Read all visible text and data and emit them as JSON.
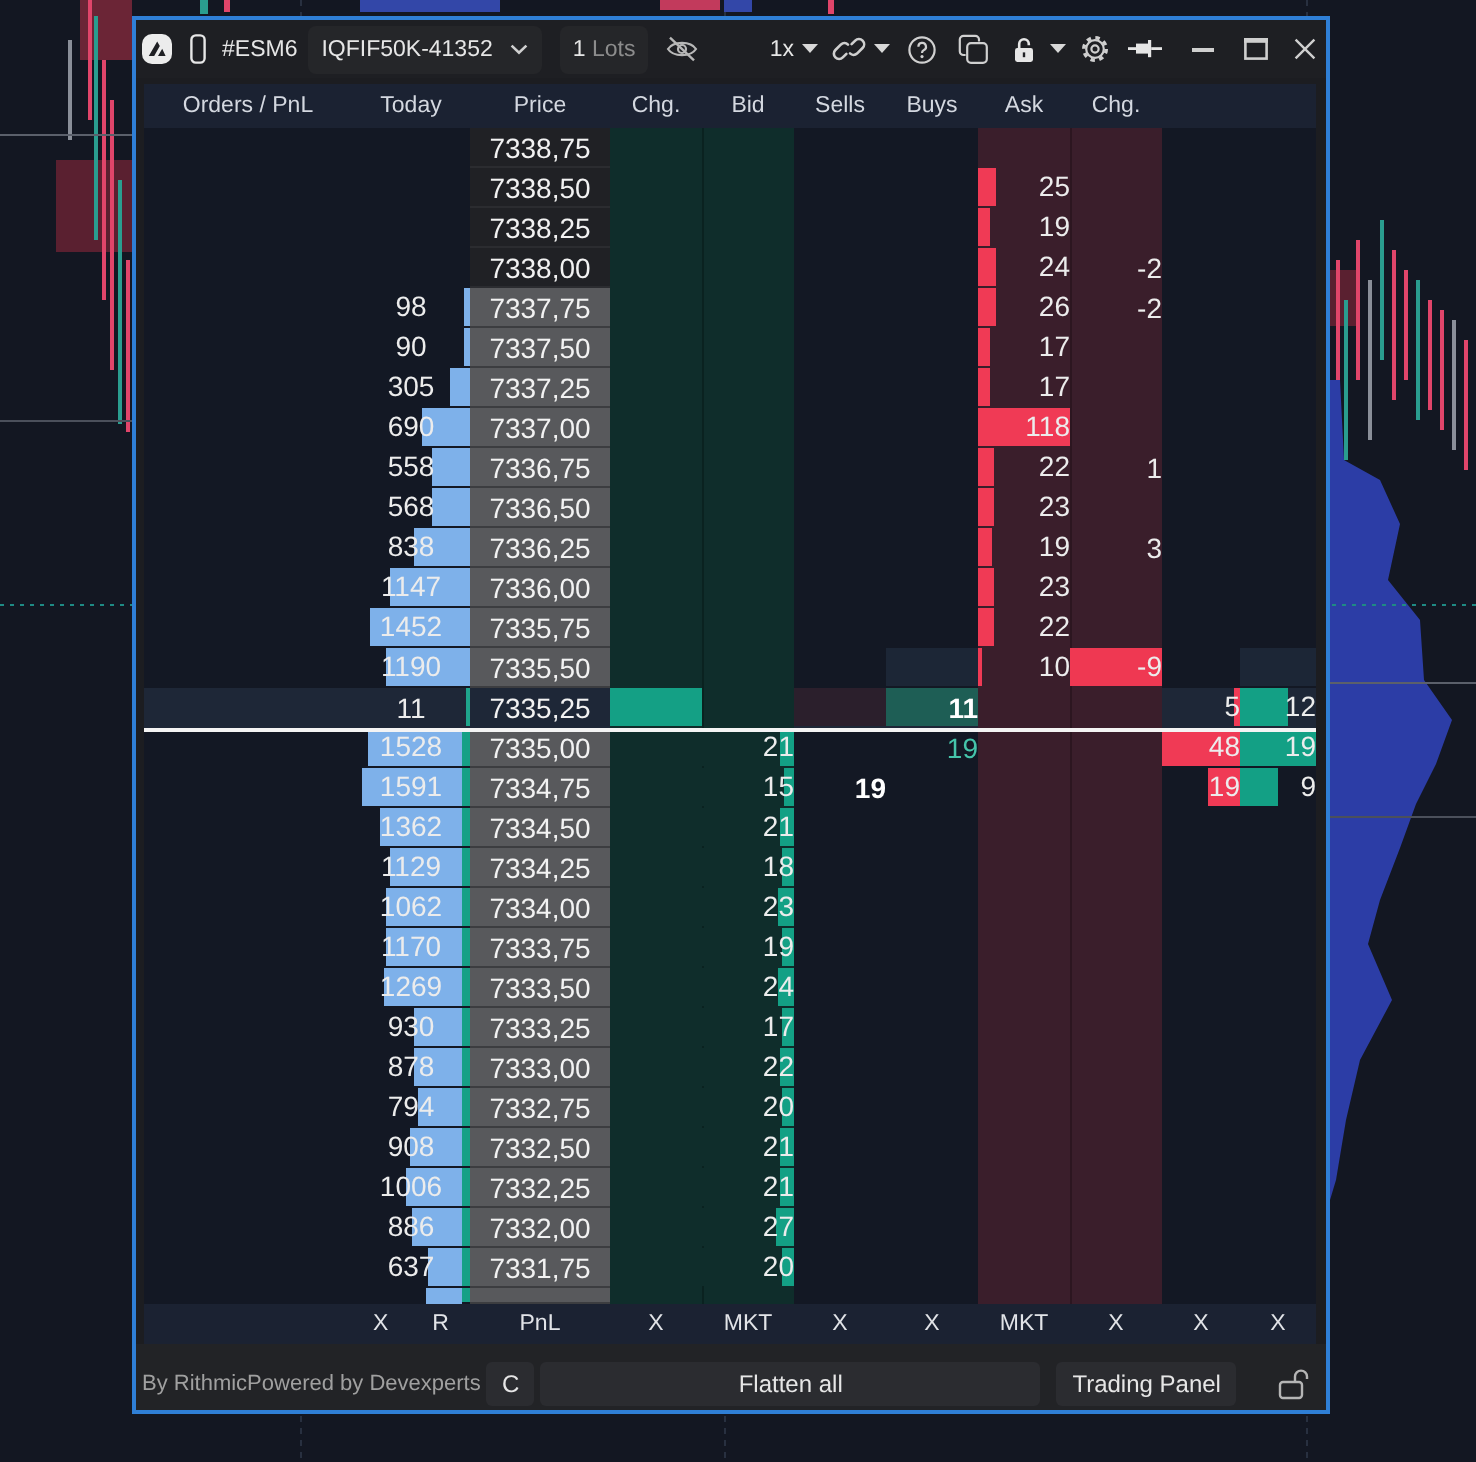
{
  "title_bar": {
    "symbol": "#ESM6",
    "account": "IQFIF50K-41352",
    "quantity": {
      "value": "1",
      "unit": "Lots"
    },
    "multiplier": "1x"
  },
  "columns": [
    "Orders / PnL",
    "Today",
    "Price",
    "Chg.",
    "Bid",
    "Sells",
    "Buys",
    "Ask",
    "Chg."
  ],
  "rows": [
    {
      "kind": "ask",
      "price": {
        "value": "7338,75",
        "shaded": false
      }
    },
    {
      "kind": "ask",
      "price": {
        "value": "7338,50",
        "shaded": false
      },
      "ask": {
        "value": "25",
        "level": 0.2
      }
    },
    {
      "kind": "ask",
      "price": {
        "value": "7338,25",
        "shaded": false
      },
      "ask": {
        "value": "19",
        "level": 0.14
      }
    },
    {
      "kind": "ask",
      "price": {
        "value": "7338,00",
        "shaded": false
      },
      "ask": {
        "value": "24",
        "level": 0.2
      },
      "ask_change": {
        "value": "-2",
        "highlighted": false
      }
    },
    {
      "kind": "ask",
      "today": {
        "value": "98",
        "level": 0.05
      },
      "price": {
        "value": "7337,75",
        "shaded": true
      },
      "ask": {
        "value": "26",
        "level": 0.2
      },
      "ask_change": {
        "value": "-2",
        "highlighted": false
      }
    },
    {
      "kind": "ask",
      "today": {
        "value": "90",
        "level": 0.05
      },
      "price": {
        "value": "7337,50",
        "shaded": true
      },
      "ask": {
        "value": "17",
        "level": 0.13
      }
    },
    {
      "kind": "ask",
      "today": {
        "value": "305",
        "level": 0.17
      },
      "price": {
        "value": "7337,25",
        "shaded": true
      },
      "ask": {
        "value": "17",
        "level": 0.13
      }
    },
    {
      "kind": "ask",
      "today": {
        "value": "690",
        "level": 0.4
      },
      "price": {
        "value": "7337,00",
        "shaded": true
      },
      "ask": {
        "value": "118",
        "level": 1
      }
    },
    {
      "kind": "ask",
      "today": {
        "value": "558",
        "level": 0.32
      },
      "price": {
        "value": "7336,75",
        "shaded": true
      },
      "ask": {
        "value": "22",
        "level": 0.17
      },
      "ask_change": {
        "value": "1",
        "highlighted": false
      }
    },
    {
      "kind": "ask",
      "today": {
        "value": "568",
        "level": 0.32
      },
      "price": {
        "value": "7336,50",
        "shaded": true
      },
      "ask": {
        "value": "23",
        "level": 0.17
      }
    },
    {
      "kind": "ask",
      "today": {
        "value": "838",
        "level": 0.48
      },
      "price": {
        "value": "7336,25",
        "shaded": true
      },
      "ask": {
        "value": "19",
        "level": 0.15
      },
      "ask_change": {
        "value": "3",
        "highlighted": false
      }
    },
    {
      "kind": "ask",
      "today": {
        "value": "1147",
        "level": 0.68
      },
      "price": {
        "value": "7336,00",
        "shaded": true
      },
      "ask": {
        "value": "23",
        "level": 0.17
      }
    },
    {
      "kind": "ask",
      "today": {
        "value": "1452",
        "level": 0.84
      },
      "price": {
        "value": "7335,75",
        "shaded": true
      },
      "ask": {
        "value": "22",
        "level": 0.17
      }
    },
    {
      "kind": "ask",
      "today": {
        "value": "1190",
        "level": 0.72
      },
      "price": {
        "value": "7335,50",
        "shaded": true
      },
      "buys": {
        "shaded": true
      },
      "ask": {
        "value": "10",
        "level": 0.05
      },
      "ask_change": {
        "value": "-9",
        "highlighted": true
      },
      "column_11": {
        "shaded": true
      }
    },
    {
      "kind": "last",
      "today": {
        "value": "11"
      },
      "price": {
        "value": "7335,25",
        "shaded": false
      },
      "bid_change": {
        "highlighted": true
      },
      "sells": {
        "highlighted": true
      },
      "buys": {
        "value": "11",
        "highlighted": true,
        "emphasis": true
      },
      "column_10": {
        "value": "5",
        "level": 0.08
      },
      "column_11": {
        "value": "12",
        "level": 0.63
      }
    },
    {
      "kind": "bid",
      "today": {
        "value": "1528",
        "level": 0.86
      },
      "price": {
        "value": "7335,00",
        "shaded": true
      },
      "bid": {
        "value": "21",
        "level": 0.15
      },
      "buys": {
        "value": "19",
        "emphasis": false
      },
      "column_10": {
        "value": "48",
        "level": 1
      },
      "column_11": {
        "value": "19",
        "level": 1
      }
    },
    {
      "kind": "bid",
      "today": {
        "value": "1591",
        "level": 0.91
      },
      "price": {
        "value": "7334,75",
        "shaded": true
      },
      "bid": {
        "value": "15",
        "level": 0.11
      },
      "sells": {
        "value": "19",
        "emphasis": true
      },
      "column_10": {
        "value": "19",
        "level": 0.4
      },
      "column_11": {
        "value": "9",
        "level": 0.5
      }
    },
    {
      "kind": "bid",
      "today": {
        "value": "1362",
        "level": 0.75
      },
      "price": {
        "value": "7334,50",
        "shaded": true
      },
      "bid": {
        "value": "21",
        "level": 0.15
      }
    },
    {
      "kind": "bid",
      "today": {
        "value": "1129",
        "level": 0.65
      },
      "price": {
        "value": "7334,25",
        "shaded": true
      },
      "bid": {
        "value": "18",
        "level": 0.13
      }
    },
    {
      "kind": "bid",
      "today": {
        "value": "1062",
        "level": 0.69
      },
      "price": {
        "value": "7334,00",
        "shaded": true
      },
      "bid": {
        "value": "23",
        "level": 0.17
      }
    },
    {
      "kind": "bid",
      "today": {
        "value": "1170",
        "level": 0.69
      },
      "price": {
        "value": "7333,75",
        "shaded": true
      },
      "bid": {
        "value": "19",
        "level": 0.14
      }
    },
    {
      "kind": "bid",
      "today": {
        "value": "1269",
        "level": 0.71
      },
      "price": {
        "value": "7333,50",
        "shaded": true
      },
      "bid": {
        "value": "24",
        "level": 0.17
      }
    },
    {
      "kind": "bid",
      "today": {
        "value": "930",
        "level": 0.44
      },
      "price": {
        "value": "7333,25",
        "shaded": true
      },
      "bid": {
        "value": "17",
        "level": 0.12
      }
    },
    {
      "kind": "bid",
      "today": {
        "value": "878",
        "level": 0.44
      },
      "price": {
        "value": "7333,00",
        "shaded": true
      },
      "bid": {
        "value": "22",
        "level": 0.16
      }
    },
    {
      "kind": "bid",
      "today": {
        "value": "794",
        "level": 0.4
      },
      "price": {
        "value": "7332,75",
        "shaded": true
      },
      "bid": {
        "value": "20",
        "level": 0.14
      }
    },
    {
      "kind": "bid",
      "today": {
        "value": "908",
        "level": 0.48
      },
      "price": {
        "value": "7332,50",
        "shaded": true
      },
      "bid": {
        "value": "21",
        "level": 0.15
      }
    },
    {
      "kind": "bid",
      "today": {
        "value": "1006",
        "level": 0.51
      },
      "price": {
        "value": "7332,25",
        "shaded": true
      },
      "bid": {
        "value": "21",
        "level": 0.15
      }
    },
    {
      "kind": "bid",
      "today": {
        "value": "886",
        "level": 0.45
      },
      "price": {
        "value": "7332,00",
        "shaded": true
      },
      "bid": {
        "value": "27",
        "level": 0.2
      }
    },
    {
      "kind": "bid",
      "today": {
        "value": "637",
        "level": 0.31
      },
      "price": {
        "value": "7331,75",
        "shaded": true
      },
      "bid": {
        "value": "20",
        "level": 0.14
      }
    },
    {
      "kind": "bid",
      "today": {
        "level": 0.32
      },
      "price": {
        "shaded": true
      }
    }
  ],
  "footer": {
    "today": [
      "X",
      "R"
    ],
    "price": [
      "PnL"
    ],
    "bid_change": [
      "X"
    ],
    "bid": [
      "MKT"
    ],
    "sells": [
      "X"
    ],
    "buys": [
      "X"
    ],
    "ask": [
      "MKT"
    ],
    "ask_change": [
      "X"
    ],
    "column_10": [
      "X"
    ],
    "column_11": [
      "X"
    ]
  },
  "status_bar": {
    "provider": "By RithmicPowered by Devexperts",
    "buttons": [
      "C",
      "Flatten all",
      "Trading Panel"
    ]
  }
}
